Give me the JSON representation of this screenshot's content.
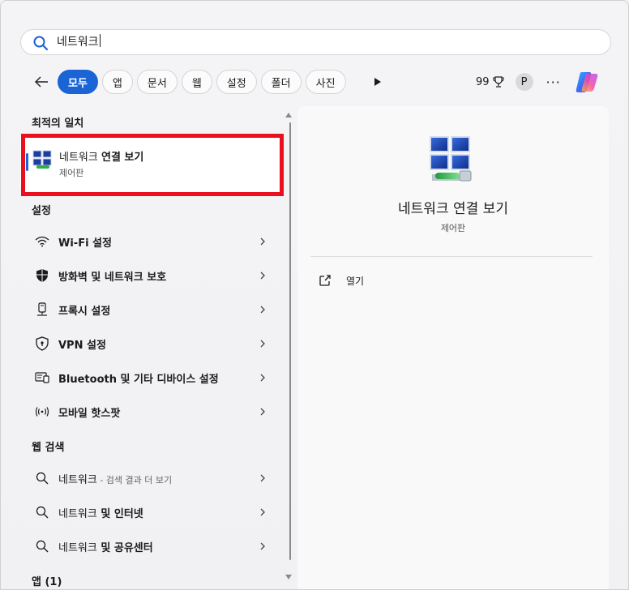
{
  "search": {
    "query": "네트워크"
  },
  "filters": {
    "chips": [
      "모두",
      "앱",
      "문서",
      "웹",
      "설정",
      "폴더",
      "사진"
    ],
    "active_index": 0
  },
  "toolbar": {
    "points": "99",
    "avatar_initial": "P",
    "more_label": "···"
  },
  "results": {
    "best_match_title": "최적의 일치",
    "best_match": {
      "name_plain": "네트워크 ",
      "name_bold": "연결 보기",
      "subtitle": "제어판",
      "icon": "network-connections-icon"
    },
    "settings_title": "설정",
    "settings_items": [
      {
        "label": "Wi-Fi 설정",
        "icon": "wifi-icon"
      },
      {
        "label": "방화벽 및 네트워크 보호",
        "icon": "shield-icon"
      },
      {
        "label": "프록시 설정",
        "icon": "proxy-icon"
      },
      {
        "label": "VPN 설정",
        "icon": "vpn-shield-icon"
      },
      {
        "label": "Bluetooth 및 기타 디바이스 설정",
        "icon": "devices-icon"
      },
      {
        "label": "모바일 핫스팟",
        "icon": "hotspot-icon"
      }
    ],
    "web_title": "웹 검색",
    "web_items": [
      {
        "plain": "네트워크",
        "extra": " - 검색 결과 더 보기"
      },
      {
        "plain": "네트워크",
        "bold": " 및 인터넷"
      },
      {
        "plain": "네트워크",
        "bold": " 및 공유센터"
      }
    ],
    "apps_title": "앱 (1)"
  },
  "detail": {
    "title": "네트워크 연결 보기",
    "subtitle": "제어판",
    "actions": [
      {
        "label": "열기",
        "icon": "open-external-icon"
      }
    ]
  },
  "colors": {
    "accent": "#1a64d6",
    "highlight_box": "#e8101e"
  }
}
